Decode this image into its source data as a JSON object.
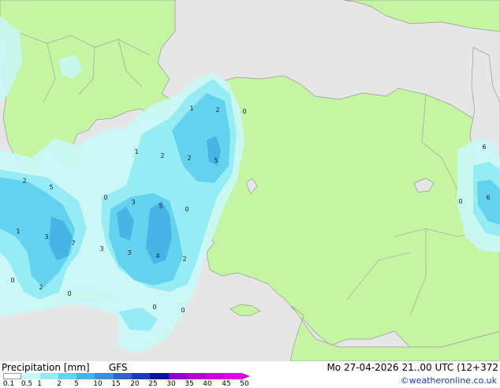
{
  "map": {
    "value_labels": [
      {
        "text": "1",
        "id": "1"
      },
      {
        "text": "2",
        "id": "2"
      },
      {
        "text": "0",
        "id": "3"
      },
      {
        "text": "1",
        "id": "4"
      },
      {
        "text": "2",
        "id": "5"
      },
      {
        "text": "2",
        "id": "6"
      },
      {
        "text": "5",
        "id": "7"
      },
      {
        "text": "6",
        "id": "8"
      },
      {
        "text": "2",
        "id": "9"
      },
      {
        "text": "5",
        "id": "10"
      },
      {
        "text": "0",
        "id": "11"
      },
      {
        "text": "3",
        "id": "12"
      },
      {
        "text": "5",
        "id": "13"
      },
      {
        "text": "0",
        "id": "14"
      },
      {
        "text": "1",
        "id": "15"
      },
      {
        "text": "3",
        "id": "16"
      },
      {
        "text": "7",
        "id": "17"
      },
      {
        "text": "3",
        "id": "18"
      },
      {
        "text": "3",
        "id": "19"
      },
      {
        "text": "4",
        "id": "20"
      },
      {
        "text": "2",
        "id": "21"
      },
      {
        "text": "0",
        "id": "22"
      },
      {
        "text": "2",
        "id": "23"
      },
      {
        "text": "0",
        "id": "24"
      },
      {
        "text": "0",
        "id": "25"
      },
      {
        "text": "0",
        "id": "26"
      },
      {
        "text": "6",
        "id": "27"
      },
      {
        "text": "0",
        "id": "28"
      },
      {
        "text": "6",
        "id": "29"
      }
    ],
    "colors": {
      "sea": "#e6e6e6",
      "land": "#c5f5a3",
      "border": "#9a9a9a",
      "precip_light": "#c8f8f8",
      "precip_1": "#96ecf4",
      "precip_2": "#64d2ee",
      "precip_5": "#46b4e6"
    }
  },
  "footer": {
    "title": "Precipitation [mm]",
    "model": "GFS",
    "valid_time": "Mo 27-04-2026 21..00 UTC (12+372",
    "credit": "©weatheronline.co.uk"
  },
  "legend": {
    "ticks": [
      "0.1",
      "0.5",
      "1",
      "2",
      "5",
      "10",
      "15",
      "20",
      "25",
      "30",
      "35",
      "40",
      "45",
      "50"
    ],
    "colors": [
      "#ffffff",
      "#c8f8f8",
      "#96ecf4",
      "#64d2ee",
      "#46b4e6",
      "#3c8cdc",
      "#3264c8",
      "#1e3cb4",
      "#0a1496",
      "#8c00c8",
      "#b400c8",
      "#d200d2",
      "#e600e6"
    ]
  }
}
